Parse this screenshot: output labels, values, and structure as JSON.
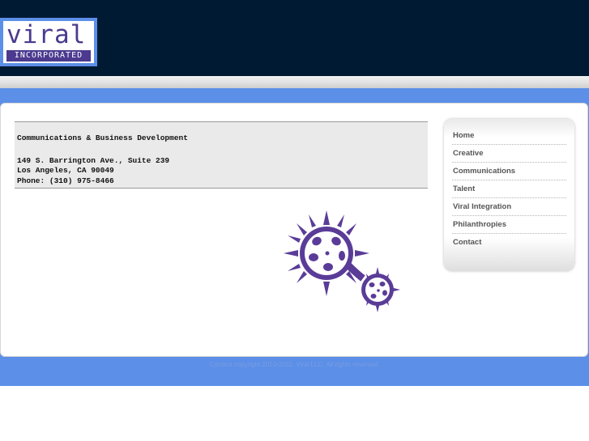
{
  "logo": {
    "word": "viral",
    "sub": "INCORPORATED"
  },
  "info": {
    "department": "Communications & Business Development",
    "address1": "149 S. Barrington Ave., Suite 239",
    "address2": "Los Angeles, CA  90049",
    "phone": "Phone: (310) 975-8466"
  },
  "nav": {
    "items": [
      {
        "label": "Home"
      },
      {
        "label": "Creative"
      },
      {
        "label": "Communications"
      },
      {
        "label": "Talent"
      },
      {
        "label": "Viral Integration"
      },
      {
        "label": "Philanthropies"
      },
      {
        "label": "Contact"
      }
    ]
  },
  "footer": {
    "copyright": "Content copyright 2010-2011. Viral LLC. All rights reserved."
  },
  "colors": {
    "header": "#001a33",
    "band": "#5b8fe8",
    "brand_purple": "#4b3a8f"
  }
}
